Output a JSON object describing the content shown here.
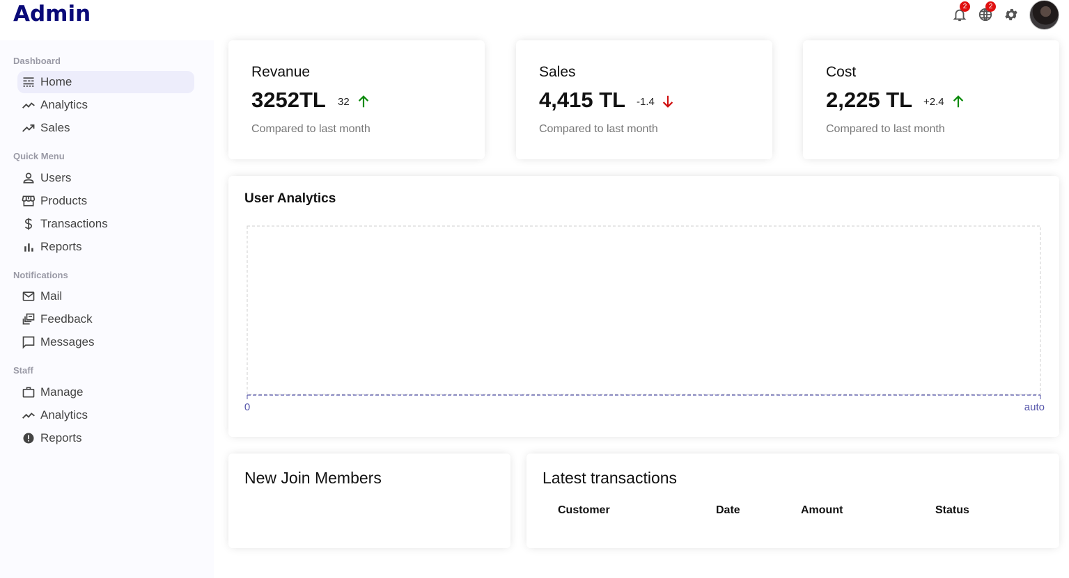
{
  "topbar": {
    "logo": "Admin",
    "notifications_badge": "2",
    "language_badge": "2",
    "icons": [
      "bell-icon",
      "globe-icon",
      "settings-icon"
    ]
  },
  "sidebar": {
    "sections": [
      {
        "title": "Dashboard",
        "items": [
          {
            "label": "Home",
            "icon": "line-style-icon",
            "active": true
          },
          {
            "label": "Analytics",
            "icon": "timeline-icon"
          },
          {
            "label": "Sales",
            "icon": "trending-up-icon"
          }
        ]
      },
      {
        "title": "Quick Menu",
        "items": [
          {
            "label": "Users",
            "icon": "person-outline-icon"
          },
          {
            "label": "Products",
            "icon": "storefront-icon"
          },
          {
            "label": "Transactions",
            "icon": "dollar-icon"
          },
          {
            "label": "Reports",
            "icon": "bar-chart-icon"
          }
        ]
      },
      {
        "title": "Notifications",
        "items": [
          {
            "label": "Mail",
            "icon": "mail-outline-icon"
          },
          {
            "label": "Feedback",
            "icon": "dynamic-feed-icon"
          },
          {
            "label": "Messages",
            "icon": "chat-bubble-outline-icon"
          }
        ]
      },
      {
        "title": "Staff",
        "items": [
          {
            "label": "Manage",
            "icon": "work-outline-icon"
          },
          {
            "label": "Analytics",
            "icon": "timeline-icon"
          },
          {
            "label": "Reports",
            "icon": "report-icon"
          }
        ]
      }
    ]
  },
  "featured": [
    {
      "title": "Revanue",
      "money": "3252TL",
      "rate": "32",
      "direction": "up",
      "sub": "Compared to last month"
    },
    {
      "title": "Sales",
      "money": "4,415 TL",
      "rate": "-1.4",
      "direction": "down",
      "sub": "Compared to last month"
    },
    {
      "title": "Cost",
      "money": "2,225 TL",
      "rate": "+2.4",
      "direction": "up",
      "sub": "Compared to last month"
    }
  ],
  "chart": {
    "title": "User Analytics",
    "x_tick_start": "0",
    "x_tick_end": "auto"
  },
  "chart_data": {
    "type": "line",
    "title": "User Analytics",
    "x": [],
    "series": [],
    "xlabel": "",
    "ylabel": "",
    "x_ticks": [
      "0",
      "auto"
    ],
    "grid": true
  },
  "widgets": {
    "members_title": "New Join Members",
    "transactions_title": "Latest transactions",
    "transactions_headers": [
      "Customer",
      "Date",
      "Amount",
      "Status"
    ]
  },
  "colors": {
    "logo": "#0a0a78",
    "up": "#0a8a0a",
    "down": "#d01010",
    "badge": "#e01010",
    "active_item": "#ededfb",
    "axis": "#5555aa"
  }
}
